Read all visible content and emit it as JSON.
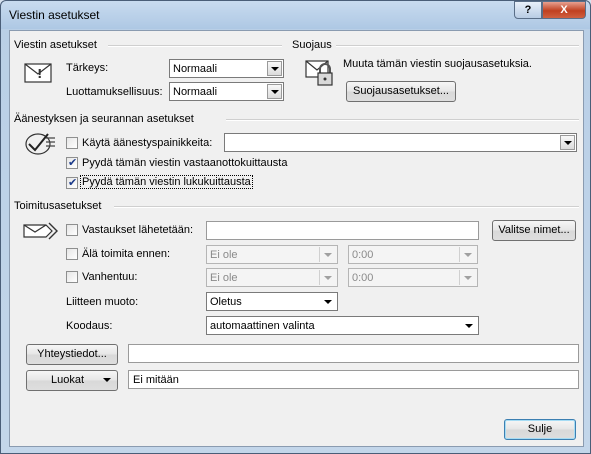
{
  "window": {
    "title": "Viestin asetukset",
    "help_glyph": "?",
    "close_glyph": "X"
  },
  "general": {
    "heading": "Viestin asetukset",
    "importance_label": "Tärkeys:",
    "importance_value": "Normaali",
    "sensitivity_label": "Luottamuksellisuus:",
    "sensitivity_value": "Normaali"
  },
  "security": {
    "heading": "Suojaus",
    "description": "Muuta tämän viestin suojausasetuksia.",
    "button_label": "Suojausasetukset..."
  },
  "voting": {
    "heading": "Äänestyksen ja seurannan asetukset",
    "use_voting_label": "Käytä äänestyspainikkeita:",
    "use_voting_checked": false,
    "voting_value": "",
    "delivery_receipt_label": "Pyydä tämän viestin vastaanottokuittausta",
    "delivery_receipt_checked": true,
    "read_receipt_label": "Pyydä tämän viestin lukukuittausta",
    "read_receipt_checked": true
  },
  "delivery": {
    "heading": "Toimitusasetukset",
    "replies_label": "Vastaukset lähetetään:",
    "replies_checked": false,
    "replies_value": "",
    "select_names_label": "Valitse nimet...",
    "not_before_label": "Älä toimita ennen:",
    "not_before_checked": false,
    "not_before_date": "Ei ole",
    "not_before_time": "0:00",
    "expires_label": "Vanhentuu:",
    "expires_checked": false,
    "expires_date": "Ei ole",
    "expires_time": "0:00",
    "attachment_format_label": "Liitteen muoto:",
    "attachment_format_value": "Oletus",
    "encoding_label": "Koodaus:",
    "encoding_value": "automaattinen valinta"
  },
  "bottom": {
    "contacts_button": "Yhteystiedot...",
    "contacts_value": "",
    "categories_button": "Luokat",
    "categories_value": "Ei mitään",
    "close_button": "Sulje"
  }
}
